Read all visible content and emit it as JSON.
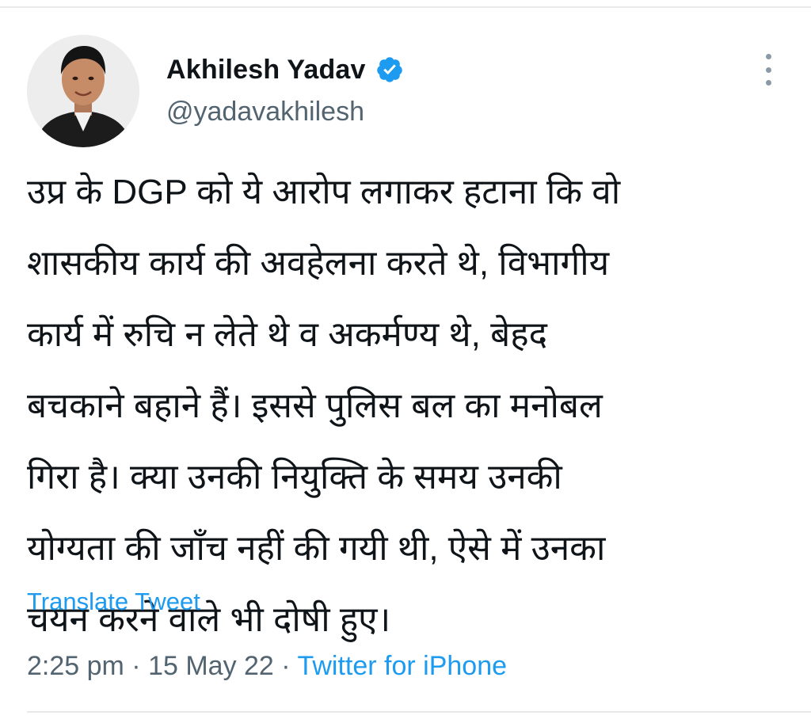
{
  "author": {
    "display_name": "Akhilesh Yadav",
    "handle": "@yadavakhilesh",
    "verified": true
  },
  "icons": {
    "verified": "verified-badge-icon",
    "more": "more-vertical-icon"
  },
  "colors": {
    "text_primary": "#0f1419",
    "text_secondary": "#536471",
    "link": "#1d9bf0",
    "verified_badge": "#1d9bf0"
  },
  "tweet": {
    "lines": [
      "उप्र के DGP को ये आरोप लगाकर हटाना कि वो",
      "शासकीय कार्य की अवहेलना करते थे, विभागीय",
      "कार्य में रुचि न लेते थे व अकर्मण्य थे, बेहद",
      "बचकाने बहाने हैं। इससे पुलिस बल का मनोबल",
      "गिरा है। क्या उनकी नियुक्ति के समय उनकी",
      "योग्यता की जाँच नहीं की गयी थी, ऐसे में उनका",
      "चयन करने वाले भी दोषी हुए।"
    ],
    "translate_label": "Translate Tweet"
  },
  "meta": {
    "time": "2:25 pm",
    "separator": " · ",
    "date": "15 May 22",
    "source": "Twitter for iPhone"
  }
}
